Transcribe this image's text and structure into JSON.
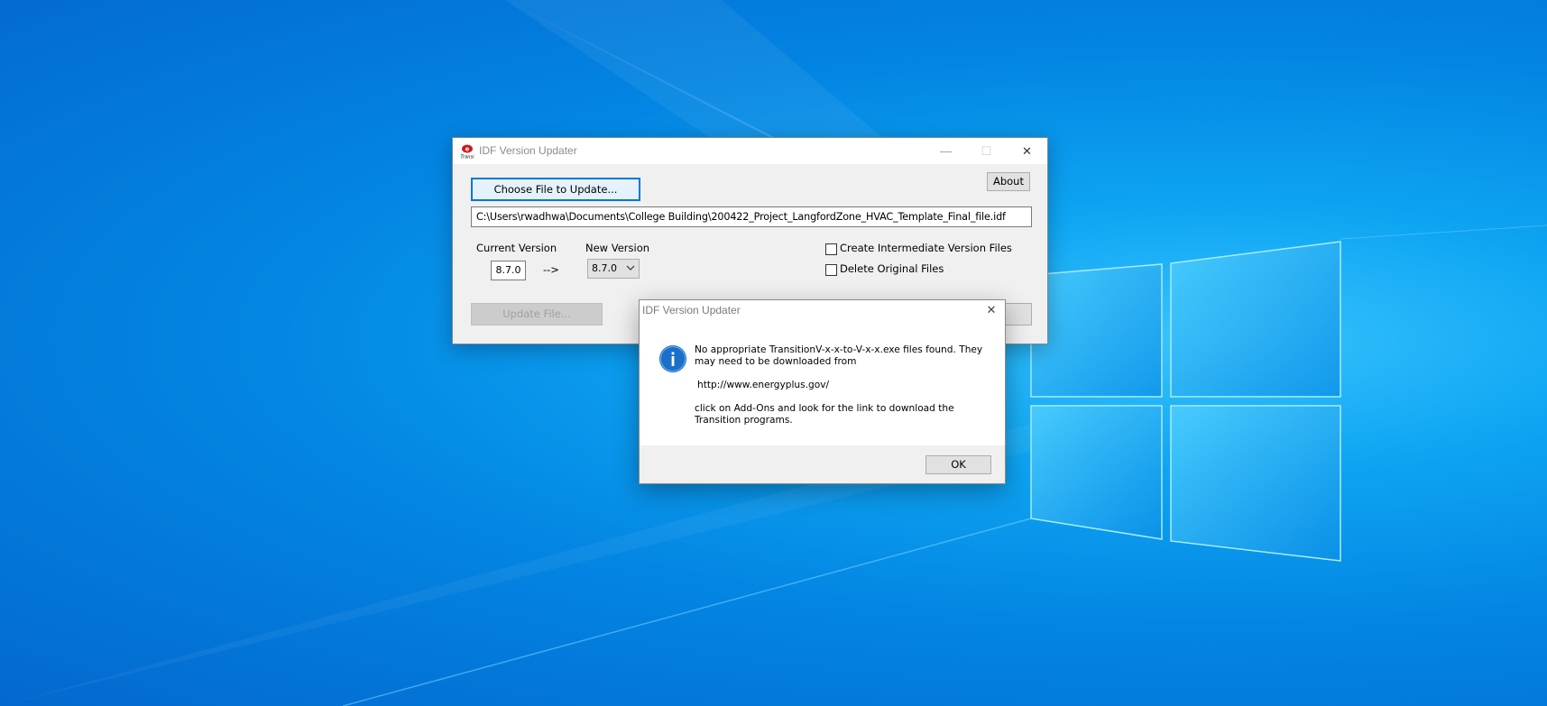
{
  "colors": {
    "accent": "#0078d7",
    "desktop": "#0a8fe8",
    "window_bg": "#f0f0f0"
  },
  "main_window": {
    "title": "IDF Version Updater",
    "app_icon": "energyplus-icon",
    "minimize_glyph": "—",
    "maximize_glyph": "☐",
    "close_glyph": "✕",
    "choose_file_label": "Choose File to Update...",
    "about_label": "About",
    "file_path": "C:\\Users\\rwadhwa\\Documents\\College Building\\200422_Project_LangfordZone_HVAC_Template_Final_file.idf",
    "current_version_label": "Current Version",
    "current_version_value": "8.7.0",
    "arrow": "-->",
    "new_version_label": "New Version",
    "new_version_value": "8.7.0",
    "create_intermediate_label": "Create Intermediate Version Files",
    "create_intermediate_checked": false,
    "delete_original_label": "Delete Original Files",
    "delete_original_checked": false,
    "update_file_label": "Update File..."
  },
  "dialog": {
    "title": "IDF Version Updater",
    "close_glyph": "✕",
    "icon": "info-icon",
    "message_line1": "No appropriate TransitionV-x-x-to-V-x-x.exe files found. They may need to be downloaded from",
    "message_url": "http://www.energyplus.gov/",
    "message_line2": "click on Add-Ons and look for the link to download the Transition programs.",
    "ok_label": "OK"
  }
}
